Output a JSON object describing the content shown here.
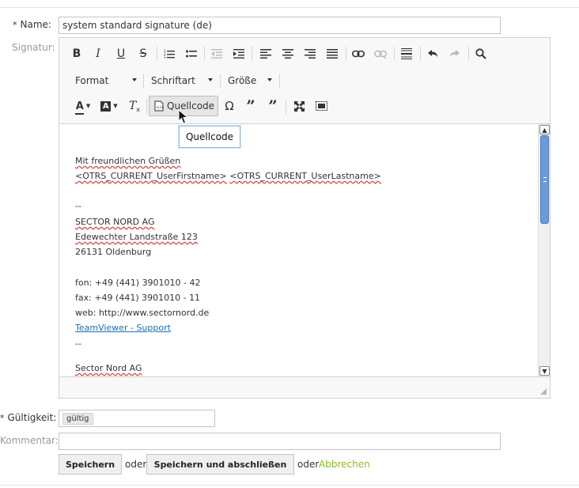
{
  "form": {
    "name_label": "Name:",
    "name_value": "system standard signature (de)",
    "signature_label": "Signatur:",
    "validity_label": "Gültigkeit:",
    "validity_value": "gültig",
    "comment_label": "Kommentar:",
    "comment_value": "",
    "required_mark": "*"
  },
  "editor": {
    "format_label": "Format",
    "font_label": "Schriftart",
    "size_label": "Größe",
    "source_label": "Quellcode",
    "tooltip": "Quellcode",
    "content": {
      "greeting": "Mit freundlichen Grüßen",
      "placeholder_first": "<OTRS_CURRENT_UserFirstname>",
      "placeholder_last": "<OTRS_CURRENT_UserLastname>",
      "sep1": "--",
      "company": "SECTOR NORD AG",
      "street": "Edewechter Landstraße 123",
      "city": "26131 Oldenburg",
      "phone": "fon: +49 (441) 3901010 - 42",
      "fax": "fax: +49 (441) 3901010 - 11",
      "web": "web: http://www.sectornord.de",
      "teamviewer_link": "TeamViewer - Support",
      "sep2": "--",
      "company2": "Sector Nord AG"
    }
  },
  "actions": {
    "save": "Speichern",
    "or1": "oder",
    "save_close": "Speichern und abschließen",
    "or2": "oder",
    "cancel": "Abbrechen"
  },
  "colors": {
    "cancel_link": "#8cbc25",
    "scroll_thumb": "#6b9bd6",
    "link": "#1a6fb5"
  }
}
